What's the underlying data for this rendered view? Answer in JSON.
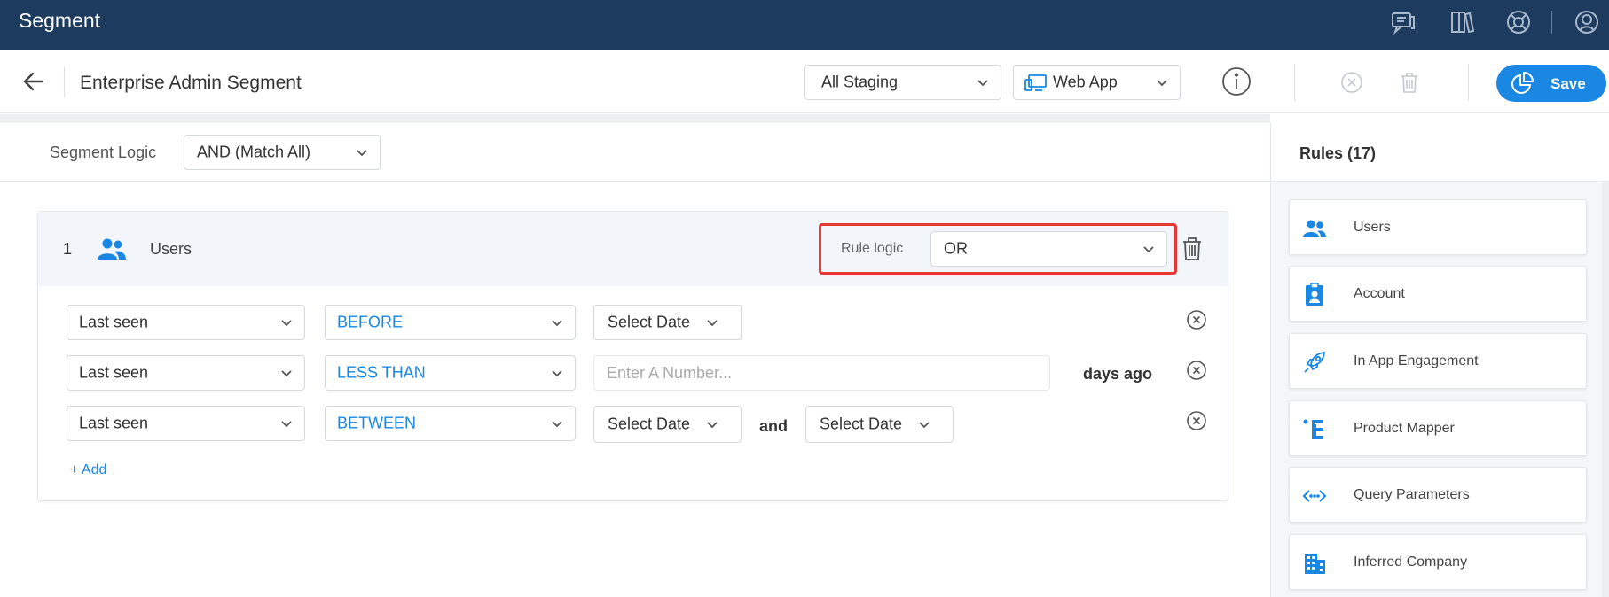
{
  "app": {
    "title": "Segment"
  },
  "colors": {
    "topbar": "#1d3a5f",
    "accent": "#1a87e3",
    "highlight": "#e53935"
  },
  "topbar_icons": [
    "chat-icon",
    "book-icon",
    "support-icon",
    "user-icon"
  ],
  "header": {
    "title": "Enterprise Admin Segment",
    "environment": "All Staging",
    "platform": "Web App",
    "save_label": "Save"
  },
  "segment_logic": {
    "label": "Segment Logic",
    "value": "AND (Match All)"
  },
  "rule": {
    "number": "1",
    "name": "Users",
    "logic_label": "Rule logic",
    "logic_value": "OR",
    "conditions": [
      {
        "attribute": "Last seen",
        "operator": "BEFORE",
        "value": "Select Date"
      },
      {
        "attribute": "Last seen",
        "operator": "LESS THAN",
        "placeholder": "Enter A Number...",
        "suffix": "days ago"
      },
      {
        "attribute": "Last seen",
        "operator": "BETWEEN",
        "value": "Select Date",
        "joiner": "and",
        "value2": "Select Date"
      }
    ],
    "add_label": "+ Add"
  },
  "rules_panel": {
    "title": "Rules (17)",
    "items": [
      {
        "label": "Users",
        "icon": "users-icon"
      },
      {
        "label": "Account",
        "icon": "account-icon"
      },
      {
        "label": "In App Engagement",
        "icon": "rocket-icon"
      },
      {
        "label": "Product Mapper",
        "icon": "product-mapper-icon"
      },
      {
        "label": "Query Parameters",
        "icon": "code-icon"
      },
      {
        "label": "Inferred Company",
        "icon": "building-icon"
      }
    ]
  }
}
